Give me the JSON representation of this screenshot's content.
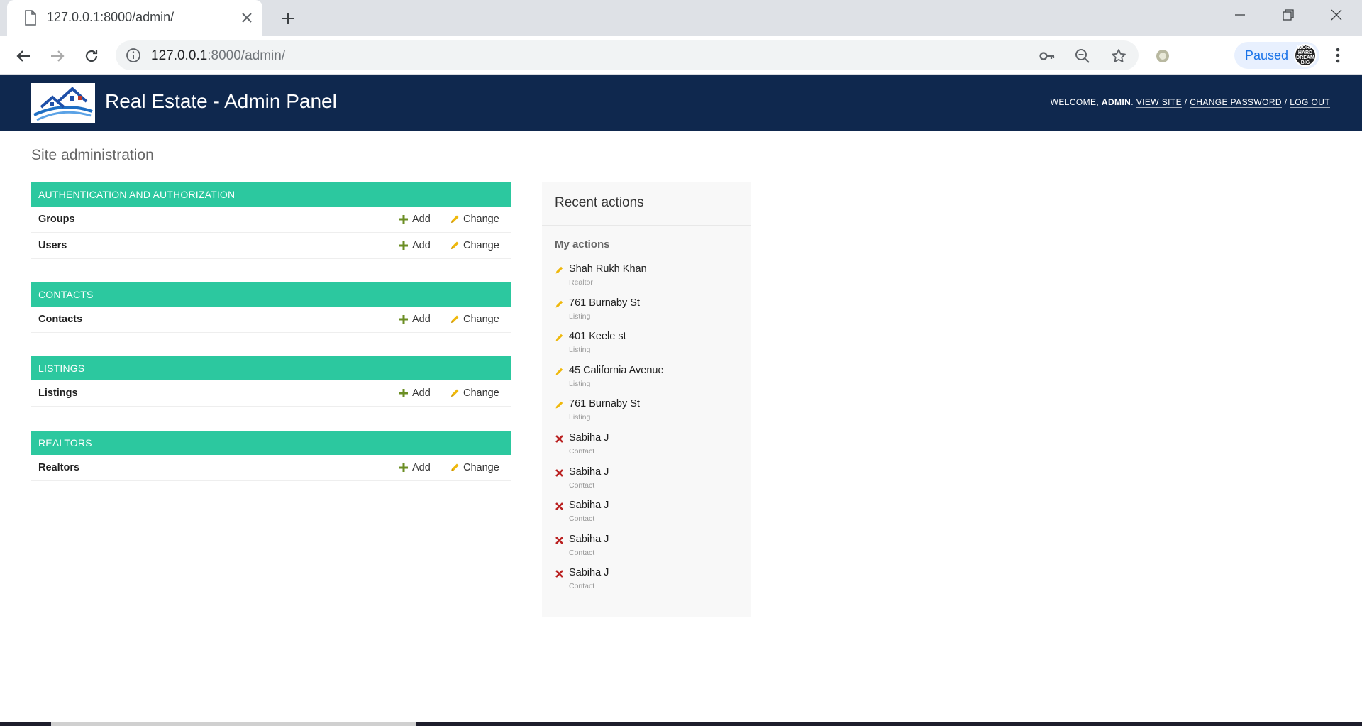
{
  "browser": {
    "tab_title": "127.0.0.1:8000/admin/",
    "url_host": "127.0.0.1",
    "url_rest": ":8000/admin/",
    "profile_status": "Paused",
    "avatar_text": "WORK HARD DREAM BIG"
  },
  "header": {
    "site_title": "Real Estate - Admin Panel",
    "welcome_label": "WELCOME,",
    "username": "ADMIN",
    "view_site": "VIEW SITE",
    "change_password": "CHANGE PASSWORD",
    "log_out": "LOG OUT",
    "separator": "/"
  },
  "page": {
    "title": "Site administration"
  },
  "actions_labels": {
    "add": "Add",
    "change": "Change"
  },
  "modules": [
    {
      "caption": "AUTHENTICATION AND AUTHORIZATION",
      "models": [
        "Groups",
        "Users"
      ]
    },
    {
      "caption": "CONTACTS",
      "models": [
        "Contacts"
      ]
    },
    {
      "caption": "LISTINGS",
      "models": [
        "Listings"
      ]
    },
    {
      "caption": "REALTORS",
      "models": [
        "Realtors"
      ]
    }
  ],
  "recent_actions": {
    "title": "Recent actions",
    "subtitle": "My actions",
    "items": [
      {
        "name": "Shah Rukh Khan",
        "type": "Realtor",
        "action": "change"
      },
      {
        "name": "761 Burnaby St",
        "type": "Listing",
        "action": "change"
      },
      {
        "name": "401 Keele st",
        "type": "Listing",
        "action": "change"
      },
      {
        "name": "45 California Avenue",
        "type": "Listing",
        "action": "change"
      },
      {
        "name": "761 Burnaby St",
        "type": "Listing",
        "action": "change"
      },
      {
        "name": "Sabiha J",
        "type": "Contact",
        "action": "delete"
      },
      {
        "name": "Sabiha J",
        "type": "Contact",
        "action": "delete"
      },
      {
        "name": "Sabiha J",
        "type": "Contact",
        "action": "delete"
      },
      {
        "name": "Sabiha J",
        "type": "Contact",
        "action": "delete"
      },
      {
        "name": "Sabiha J",
        "type": "Contact",
        "action": "delete"
      }
    ]
  },
  "colors": {
    "header_bg": "#0f284e",
    "module_caption_bg": "#2cc89f",
    "add_icon": "#6b8e23",
    "change_icon": "#efb80b",
    "delete_icon": "#ba2121"
  }
}
